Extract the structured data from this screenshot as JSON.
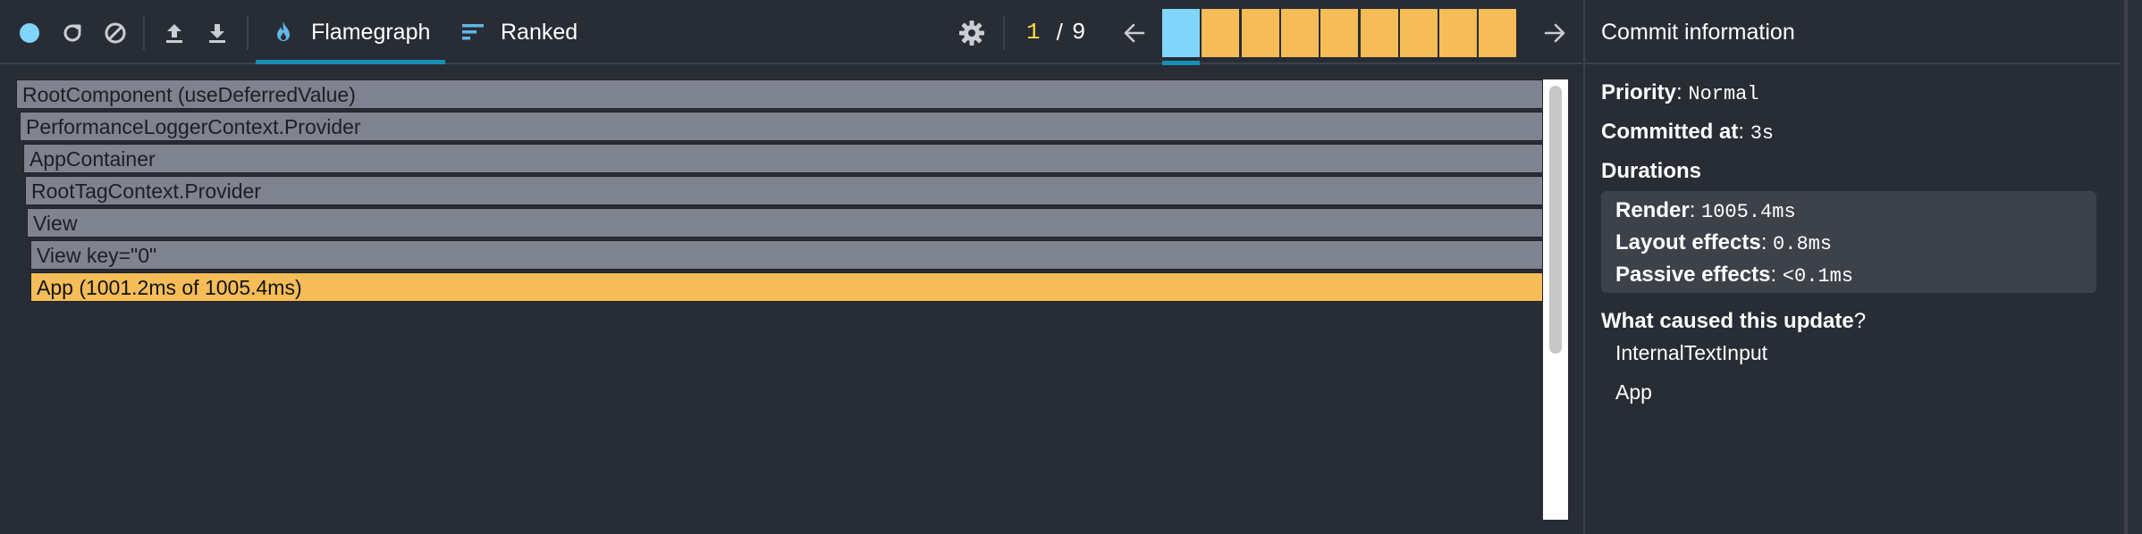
{
  "toolbar": {
    "record_icon": "record-circle-icon",
    "reload_icon": "reload-icon",
    "clear_icon": "clear-icon",
    "load_icon": "upload-icon",
    "save_icon": "download-icon",
    "tabs": [
      {
        "label": "Flamegraph",
        "icon": "flame-icon",
        "active": true
      },
      {
        "label": "Ranked",
        "icon": "ranked-icon",
        "active": false
      }
    ],
    "settings_icon": "gear-icon",
    "commit_index": "1",
    "commit_separator": "/",
    "commit_total": "9",
    "prev_icon": "arrow-left-icon",
    "next_icon": "arrow-right-icon",
    "commits": [
      {
        "selected": true
      },
      {
        "selected": false
      },
      {
        "selected": false
      },
      {
        "selected": false
      },
      {
        "selected": false
      },
      {
        "selected": false
      },
      {
        "selected": false
      },
      {
        "selected": false
      },
      {
        "selected": false
      }
    ]
  },
  "flamegraph": {
    "rows": [
      {
        "label": "RootComponent (useDeferredValue)",
        "hot": false
      },
      {
        "label": "PerformanceLoggerContext.Provider",
        "hot": false
      },
      {
        "label": "AppContainer",
        "hot": false
      },
      {
        "label": "RootTagContext.Provider",
        "hot": false
      },
      {
        "label": "View",
        "hot": false
      },
      {
        "label": "View key=\"0\"",
        "hot": false
      },
      {
        "label": "App (1001.2ms of 1005.4ms)",
        "hot": true
      }
    ]
  },
  "commit_info": {
    "title": "Commit information",
    "priority_label": "Priority",
    "priority_value": "Normal",
    "committed_label": "Committed at",
    "committed_value": "3s",
    "durations_title": "Durations",
    "render_label": "Render",
    "render_value": "1005.4ms",
    "layout_label": "Layout effects",
    "layout_value": "0.8ms",
    "passive_label": "Passive effects",
    "passive_value": "<0.1ms",
    "cause_title": "What caused this update",
    "cause_q": "?",
    "causes": [
      "InternalTextInput",
      "App"
    ]
  },
  "colors": {
    "background": "#282c34",
    "accent": "#178fb9",
    "commit_selected": "#81d4fa",
    "commit_default": "#f5bc57",
    "flame_default": "#7f828f",
    "flame_hot": "#f5bc57",
    "counter_current": "#ffd94a"
  }
}
